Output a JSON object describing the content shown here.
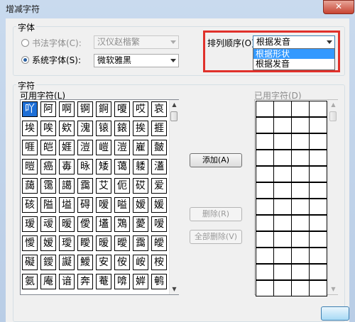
{
  "window": {
    "title": "增减字符",
    "close_glyph": "✕"
  },
  "font_group": {
    "label": "字体",
    "calligraphy_label": "书法字体(C):",
    "calligraphy_value": "汉仪赵楷繁",
    "system_label": "系统字体(S):",
    "system_value": "微软雅黑"
  },
  "sort": {
    "label": "排列顺序(O):",
    "value": "根据发音",
    "options": [
      "根据形状",
      "根据发音"
    ],
    "highlight_color": "#e0312b"
  },
  "chars_group": {
    "label": "字符",
    "available_label": "可用字符(L)",
    "used_label": "已用字符(D)",
    "rows": [
      [
        "吖",
        "阿",
        "啊",
        "锕",
        "錒",
        "嗄",
        "哎",
        "哀"
      ],
      [
        "埃",
        "唉",
        "欸",
        "溾",
        "锿",
        "鎄",
        "挨",
        "捱"
      ],
      [
        "啀",
        "皑",
        "娾",
        "溰",
        "嵦",
        "溰",
        "嵟",
        "皼"
      ],
      [
        "暟",
        "癌",
        "毐",
        "昹",
        "矮",
        "蔼",
        "躷",
        "濭"
      ],
      [
        "藹",
        "霭",
        "譪",
        "靄",
        "艾",
        "伌",
        "砹",
        "爱"
      ],
      [
        "硋",
        "隘",
        "塧",
        "碍",
        "嗳",
        "嗌",
        "嫒",
        "媛"
      ],
      [
        "瑷",
        "叆",
        "暧",
        "僾",
        "壒",
        "鴱",
        "薆",
        "嗳"
      ],
      [
        "懓",
        "嫒",
        "璦",
        "瞹",
        "暧",
        "曖",
        "靄",
        "皧"
      ],
      [
        "礙",
        "鑀",
        "譺",
        "鱫",
        "安",
        "侒",
        "峖",
        "桉"
      ],
      [
        "氨",
        "庵",
        "谙",
        "奔",
        "菴",
        "啽",
        "婩",
        "鹌"
      ]
    ]
  },
  "buttons": {
    "add": "添加(A)",
    "delete": "删除(R)",
    "delete_all": "全部删除(V)"
  },
  "colors": {
    "selected_cell": "#1e6fd6",
    "selected_option": "#3399ff"
  }
}
